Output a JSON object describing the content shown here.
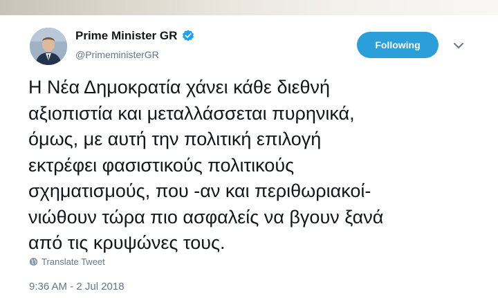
{
  "author": {
    "name": "Prime Minister GR",
    "handle": "@PrimeministerGR",
    "verified": true
  },
  "follow_button": {
    "label": "Following",
    "color": "#2b9fd9"
  },
  "icons": {
    "verified": "verified-badge-icon",
    "caret": "chevron-down-icon",
    "translate": "globe-icon"
  },
  "tweet": {
    "lines": [
      "Η Νέα Δημοκρατία χάνει κάθε διεθνή",
      "αξιοπιστία και μεταλλάσσεται πυρηνικά,",
      "όμως, με αυτή την πολιτική επιλογή",
      "εκτρέφει φασιστικούς πολιτικούς",
      "σχηματισμούς, που -αν και περιθωριακοί-",
      "νιώθουν τώρα πιο ασφαλείς να βγουν ξανά",
      "από τις κρυψώνες τους."
    ],
    "translate_label": "Translate Tweet",
    "timestamp": "9:36 AM - 2 Jul 2018"
  }
}
